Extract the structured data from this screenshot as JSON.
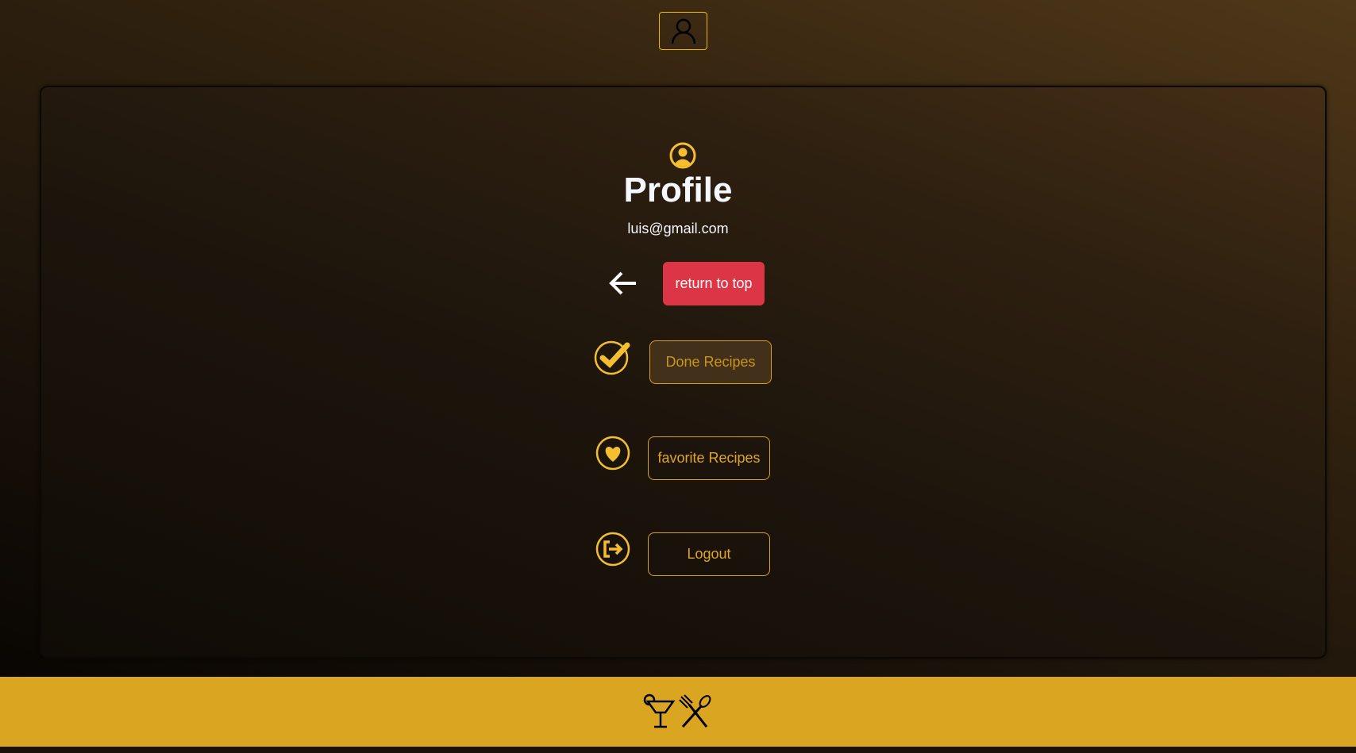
{
  "header": {
    "profile_button_icon": "user-icon"
  },
  "profile": {
    "title": "Profile",
    "email": "luis@gmail.com",
    "icon": "user-circle-icon"
  },
  "actions": {
    "back_icon": "arrow-left-icon",
    "return_label": "return to top",
    "done_label": "Done Recipes",
    "favorite_label": "favorite Recipes",
    "logout_label": "Logout"
  },
  "footer": {
    "icons": [
      "cocktail-icon",
      "fork-spoon-icon"
    ]
  },
  "colors": {
    "accent": "#daa520",
    "danger": "#dc3545",
    "icon_yellow": "#f5be2e"
  }
}
